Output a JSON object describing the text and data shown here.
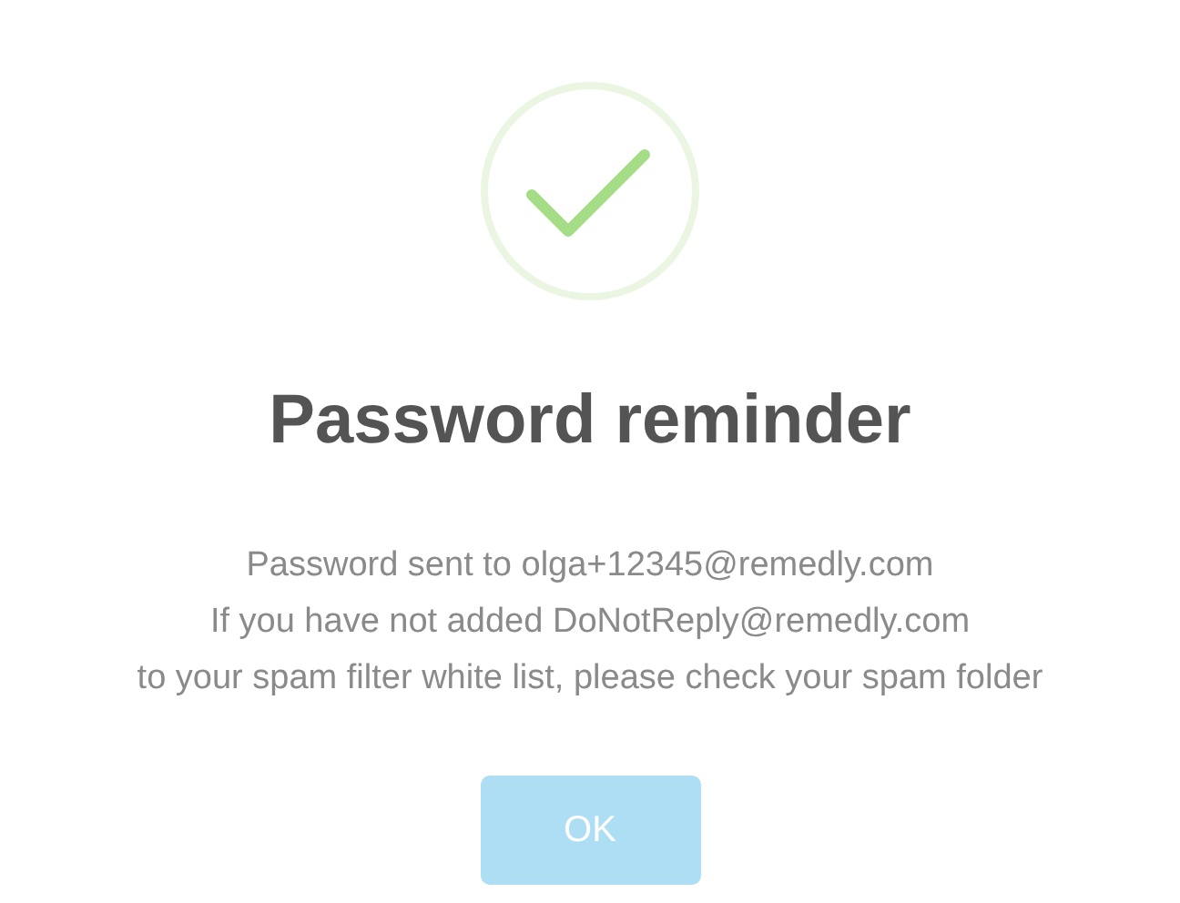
{
  "dialog": {
    "title": "Password reminder",
    "message_lines": [
      "Password sent to olga+12345@remedly.com",
      "If you have not added DoNotReply@remedly.com",
      "to your spam filter white list, please check your spam folder"
    ],
    "buttons": [
      {
        "label": "OK"
      }
    ]
  }
}
